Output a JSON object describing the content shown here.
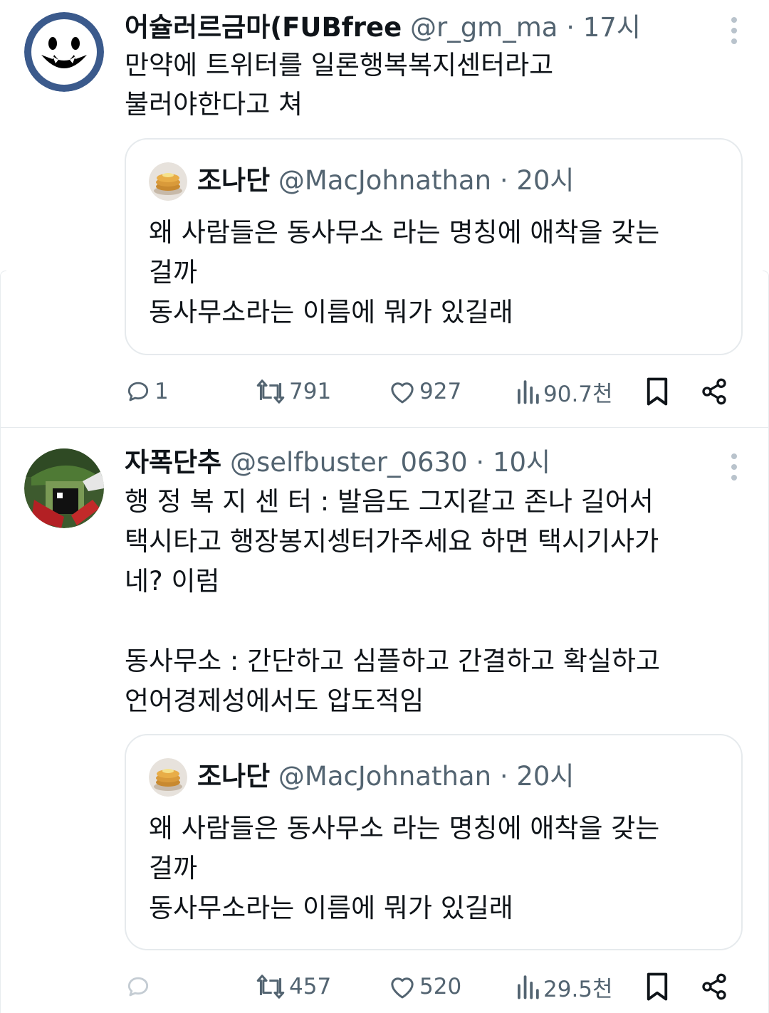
{
  "tweets": [
    {
      "display_name": "어슐러르금마(FUBfree",
      "handle": "@r_gm_ma",
      "time": "· 17시",
      "text_lines": [
        "만약에 트위터를 일론행복복지센터라고",
        "불러야한다고 쳐"
      ],
      "quote": {
        "display_name": "조나단",
        "handle": "@MacJohnathan",
        "time": "· 20시",
        "text_lines": [
          "왜 사람들은 동사무소 라는 명칭에 애착을 갖는",
          "걸까",
          "동사무소라는 이름에 뭐가 있길래"
        ]
      },
      "actions": {
        "reply": "1",
        "retweet": "791",
        "like": "927",
        "views": "90.7천"
      }
    },
    {
      "display_name": "자폭단추",
      "handle": "@selfbuster_0630",
      "time": "· 10시",
      "text_lines": [
        "행 정 복 지 센 터 : 발음도 그지같고 존나 길어서",
        "택시타고 행장봉지셍터가주세요 하면 택시기사가",
        "네? 이럼",
        "",
        "동사무소 : 간단하고 심플하고 간결하고 확실하고",
        "언어경제성에서도 압도적임"
      ],
      "quote": {
        "display_name": "조나단",
        "handle": "@MacJohnathan",
        "time": "· 20시",
        "text_lines": [
          "왜 사람들은 동사무소 라는 명칭에 애착을 갖는",
          "걸까",
          "동사무소라는 이름에 뭐가 있길래"
        ]
      },
      "actions": {
        "reply": "",
        "retweet": "457",
        "like": "520",
        "views": "29.5천"
      }
    }
  ],
  "icons": {
    "reply": "reply-icon",
    "retweet": "retweet-icon",
    "like": "heart-icon",
    "views": "views-icon",
    "bookmark": "bookmark-icon",
    "share": "share-icon",
    "more": "more-icon"
  },
  "colors": {
    "text": "#0f1419",
    "muted": "#536471",
    "border": "#e6eaed",
    "avatar1_ring": "#3b5a8c"
  }
}
